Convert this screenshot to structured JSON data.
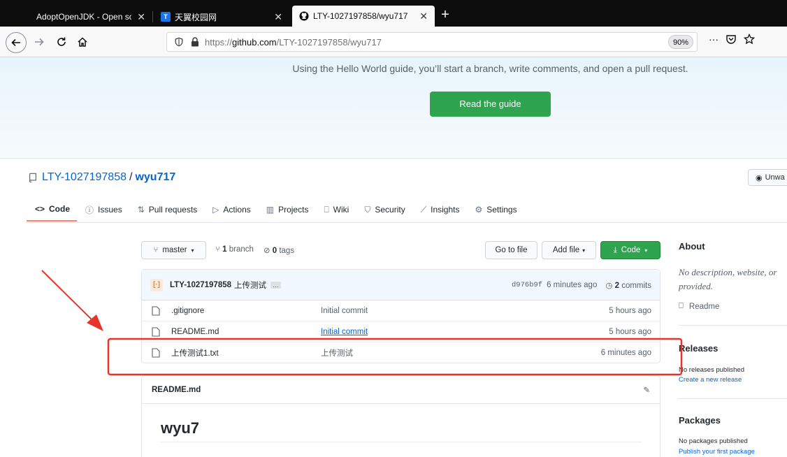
{
  "browser": {
    "tabs": [
      {
        "title": "AdoptOpenJDK - Open sour",
        "favicon": "adoptopenjdk-icon"
      },
      {
        "title": "天翼校园网",
        "favicon": "tianyi-icon"
      },
      {
        "title": "LTY-1027197858/wyu717",
        "favicon": "github-icon"
      }
    ],
    "new_tab_label": "+",
    "url_prefix": "https://",
    "url_host": "github.com",
    "url_path": "/LTY-1027197858/wyu717",
    "zoom": "90%",
    "more_label": "···"
  },
  "banner": {
    "text": "Using the Hello World guide, you’ll start a branch, write comments, and open a pull request.",
    "button": "Read the guide"
  },
  "repo": {
    "owner": "LTY-1027197858",
    "separator": "/",
    "name": "wyu717",
    "unwatch": "Unwa"
  },
  "tabs": [
    {
      "label": "Code",
      "icon": "<>"
    },
    {
      "label": "Issues",
      "icon": "ⓘ"
    },
    {
      "label": "Pull requests",
      "icon": "⇅"
    },
    {
      "label": "Actions",
      "icon": "▷"
    },
    {
      "label": "Projects",
      "icon": "▥"
    },
    {
      "label": "Wiki",
      "icon": "⎕"
    },
    {
      "label": "Security",
      "icon": "⛉"
    },
    {
      "label": "Insights",
      "icon": "⟋"
    },
    {
      "label": "Settings",
      "icon": "⚙"
    }
  ],
  "filenav": {
    "branch": "master",
    "branch_count": "1",
    "branch_word": "branch",
    "tag_count": "0",
    "tag_word": "tags",
    "goto_file": "Go to file",
    "add_file": "Add file",
    "code": "Code"
  },
  "commit": {
    "author": "LTY-1027197858",
    "message": "上传测试",
    "ellipsis": "…",
    "sha": "d976b9f",
    "age": "6 minutes ago",
    "count": "2",
    "count_word": "commits"
  },
  "files": [
    {
      "name": ".gitignore",
      "message": "Initial commit",
      "age": "5 hours ago"
    },
    {
      "name": "README.md",
      "message": "Initial commit",
      "age": "5 hours ago"
    },
    {
      "name": "上传测试1.txt",
      "message": "上传测试",
      "age": "6 minutes ago"
    }
  ],
  "readme": {
    "filename": "README.md",
    "heading": "wyu7"
  },
  "sidebar": {
    "about_title": "About",
    "about_desc": "No description, website, or provided.",
    "readme_label": "Readme",
    "releases_title": "Releases",
    "releases_none": "No releases published",
    "releases_link": "Create a new release",
    "packages_title": "Packages",
    "packages_none": "No packages published",
    "packages_link": "Publish your first package"
  },
  "colors": {
    "primary_button": "#2ea44f",
    "link": "#0366d6",
    "tab_underline": "#f9826c",
    "annotation": "#e8332b"
  }
}
